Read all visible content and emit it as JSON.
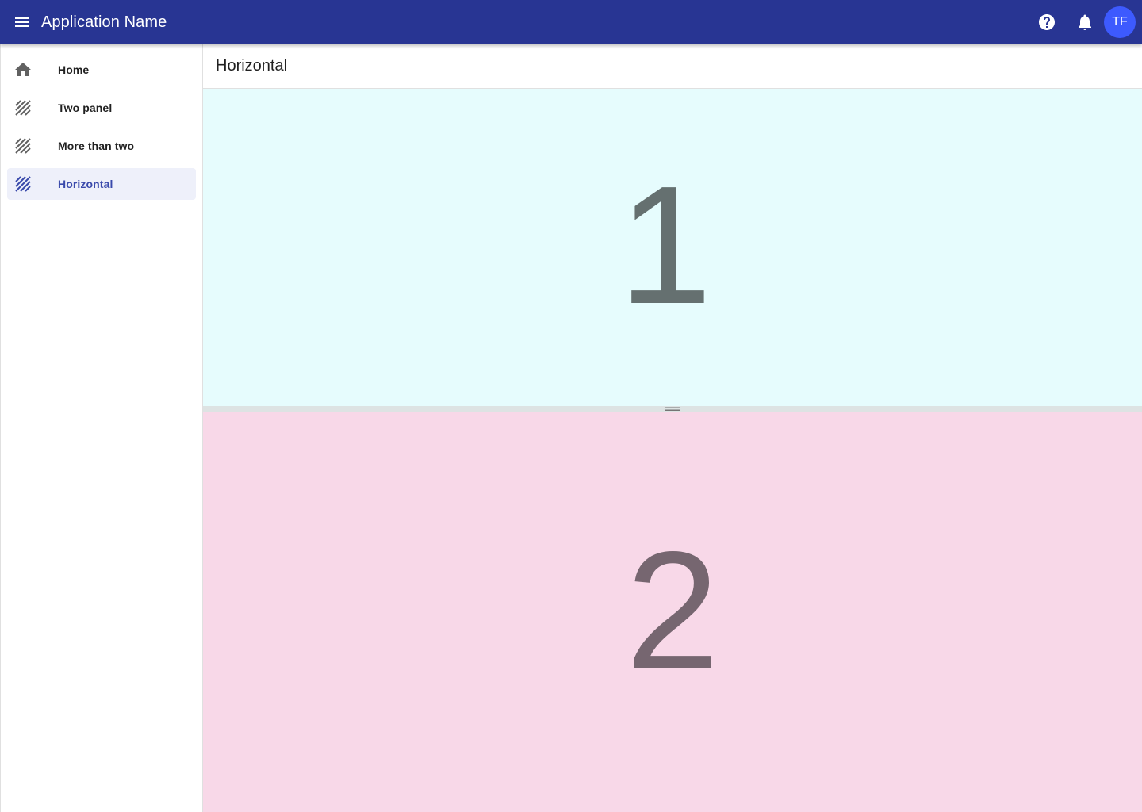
{
  "app": {
    "title": "Application Name",
    "avatar_initials": "TF",
    "colors": {
      "appbar": "#283593",
      "avatar": "#3d5afe",
      "active_nav": "#3949ab"
    }
  },
  "sidebar": {
    "items": [
      {
        "label": "Home",
        "icon": "home-icon",
        "active": false
      },
      {
        "label": "Two panel",
        "icon": "hatch-icon",
        "active": false
      },
      {
        "label": "More than two",
        "icon": "hatch-icon",
        "active": false
      },
      {
        "label": "Horizontal",
        "icon": "hatch-icon",
        "active": true
      }
    ]
  },
  "main": {
    "title": "Horizontal",
    "panels": [
      {
        "label": "1",
        "color": "#e6fcfd"
      },
      {
        "label": "2",
        "color": "#f8d8e8"
      }
    ]
  }
}
